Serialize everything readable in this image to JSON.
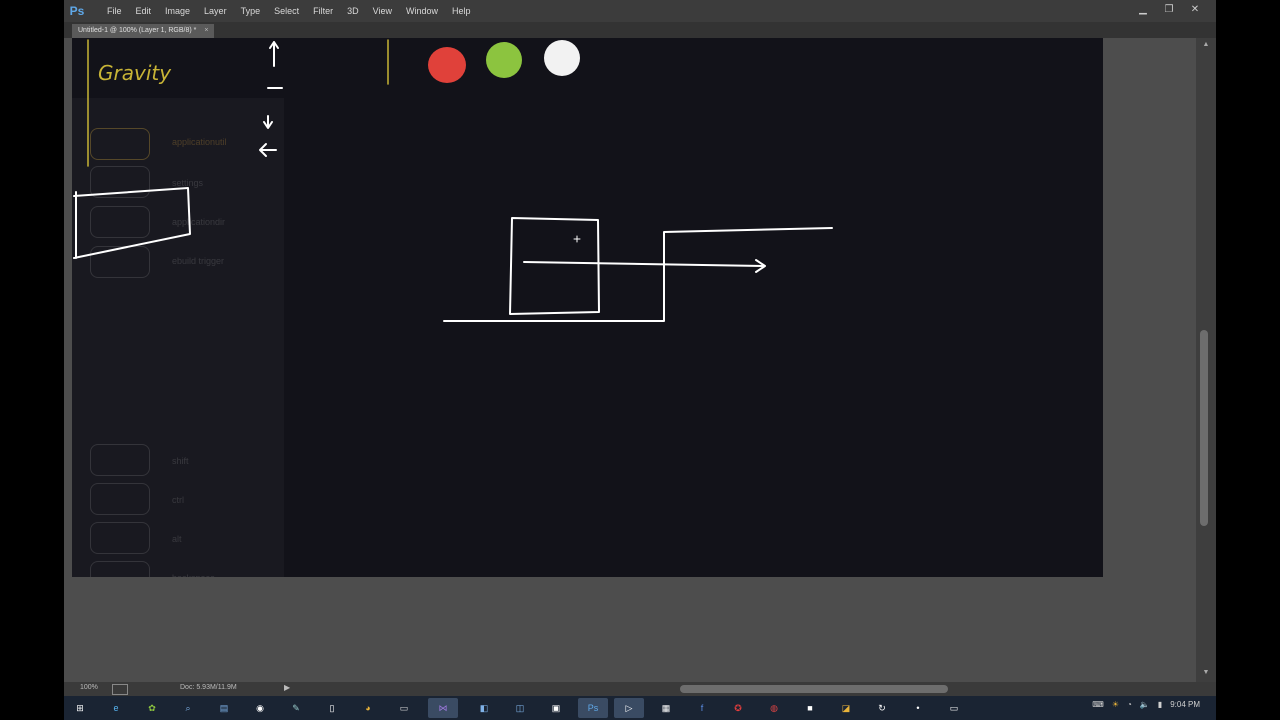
{
  "app": {
    "logo": "Ps",
    "menu": [
      "File",
      "Edit",
      "Image",
      "Layer",
      "Type",
      "Select",
      "Filter",
      "3D",
      "View",
      "Window",
      "Help"
    ],
    "window_controls": {
      "minimize": "minimize-icon",
      "restore": "restore-icon",
      "close": "close-icon"
    },
    "document_tab": {
      "title": "Untitled-1 @ 100% (Layer 1, RGB/8) *",
      "close": "×"
    }
  },
  "canvas": {
    "handwritten_text": "Gravity",
    "circles": [
      {
        "color": "#e0413a"
      },
      {
        "color": "#8cc43f"
      },
      {
        "color": "#f2f2f2"
      }
    ],
    "background": "#121219",
    "stroke_color": "#ffffff",
    "accent_stroke": "#c8b436",
    "ghost_panel": {
      "top_labels": [
        "applicationutil",
        "settings",
        "applicationdir",
        "ebuild trigger"
      ],
      "bottom_labels": [
        "shift",
        "ctrl",
        "alt",
        "backspace"
      ]
    }
  },
  "status": {
    "zoom": "100%",
    "doc": "Doc: 5.93M/11.9M",
    "arrow": "▶"
  },
  "taskbar": {
    "icons": [
      "windows-start-icon",
      "ie-icon",
      "android-icon",
      "search-icon",
      "files-icon",
      "steam-icon",
      "pen-icon",
      "file-icon",
      "chrome-icon",
      "explorer-icon",
      "visual-studio-icon",
      "ps-icon",
      "app-icon",
      "photoshop-icon",
      "media-icon",
      "bin-icon",
      "facebook-icon",
      "acrobat-icon",
      "app2-icon",
      "terminal-icon",
      "app3-icon",
      "refresh-icon",
      "app4-icon",
      "app5-icon"
    ],
    "clock": "9:04 PM"
  }
}
